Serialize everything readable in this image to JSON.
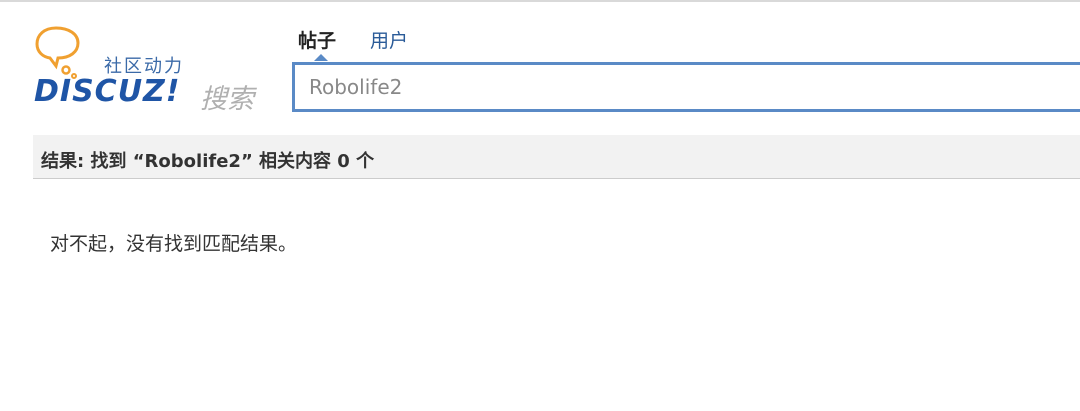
{
  "logo": {
    "tagline": "社区动力",
    "wordmark": "DISCUZ!",
    "suffix": "搜索",
    "colors": {
      "wordmark": "#1f55a6",
      "bubble": "#f0a030",
      "suffix": "#b0b0b0"
    }
  },
  "tabs": [
    {
      "label": "帖子",
      "active": true
    },
    {
      "label": "用户",
      "active": false
    }
  ],
  "search": {
    "value": "Robolife2",
    "border_color": "#5a8ac6"
  },
  "results": {
    "summary": "结果: 找到 “Robolife2” 相关内容 0 个"
  },
  "message": {
    "empty": "对不起，没有找到匹配结果。"
  }
}
